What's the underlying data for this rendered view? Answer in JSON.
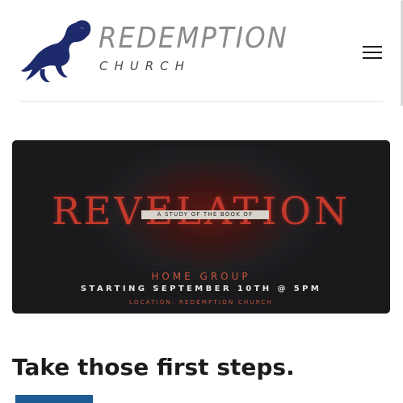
{
  "header": {
    "logo": {
      "name": "REDEMPTION",
      "subtitle": "CHURCH",
      "icon": "ram-icon",
      "icon_color": "#1d2a6b",
      "text_color": "#8a8b8f"
    },
    "menu_icon": "hamburger-menu-icon"
  },
  "banner": {
    "title": "REVELATION",
    "subtitle": "A STUDY OF THE BOOK OF",
    "line1": "HOME GROUP",
    "line2": "STARTING SEPTEMBER 10TH @ 5PM",
    "line3": "LOCATION: REDEMPTION CHURCH",
    "accent_color": "#c23a2c"
  },
  "main": {
    "headline": "Take those first steps.",
    "button_color": "#1d5c94"
  }
}
